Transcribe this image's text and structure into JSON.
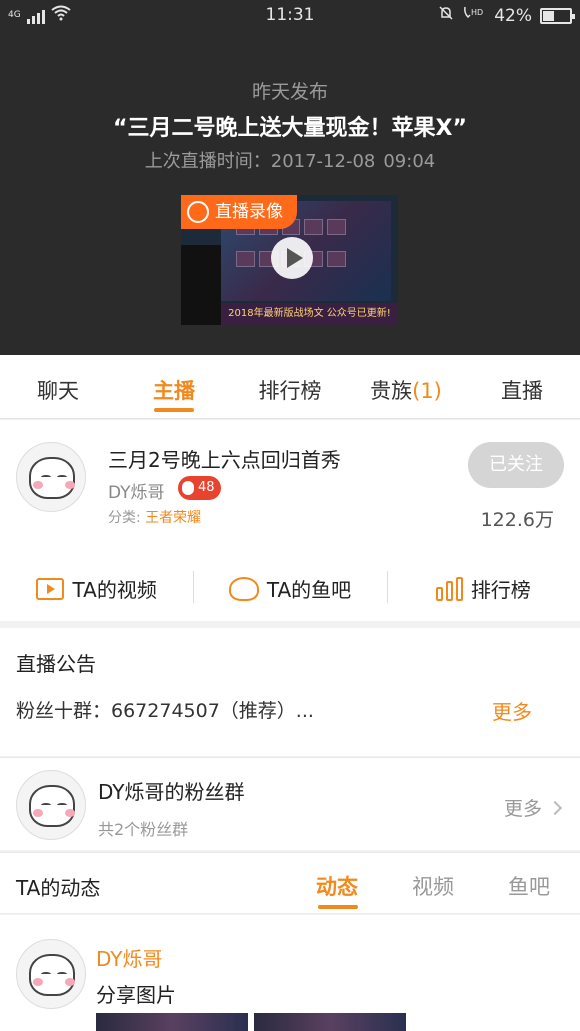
{
  "status_bar": {
    "time": "11:31",
    "network": "4G",
    "battery": "42%",
    "battery_level": 0.42,
    "icons": [
      "signal-icon",
      "wifi-icon",
      "mute-bell-icon",
      "hd-volte-icon",
      "battery-icon"
    ]
  },
  "header": {
    "posted": "昨天发布",
    "title": "“三月二号晚上送大量现金！苹果X”",
    "last_live_label": "上次直播时间：2017-12-08",
    "last_live_time": "09:04",
    "video_badge": "直播录像",
    "video_caption": "2018年最新版战场文 公众号已更新!"
  },
  "tabs": [
    {
      "label": "聊天",
      "count": ""
    },
    {
      "label": "主播",
      "count": ""
    },
    {
      "label": "排行榜",
      "count": ""
    },
    {
      "label": "贵族",
      "count": "(1)"
    },
    {
      "label": "直播",
      "count": ""
    }
  ],
  "active_tab": "主播",
  "anchor": {
    "title": "三月2号晚上六点回归首秀",
    "name": "DY烁哥",
    "level": "48",
    "category_label": "分类:",
    "category": "王者荣耀",
    "follow_label": "已关注",
    "fans": "122.6万"
  },
  "actions": [
    {
      "label": "TA的视频",
      "icon": "video-icon"
    },
    {
      "label": "TA的鱼吧",
      "icon": "fish-bar-icon"
    },
    {
      "label": "排行榜",
      "icon": "rank-bars-icon"
    }
  ],
  "notice": {
    "title": "直播公告",
    "text": "粉丝十群：667274507（推荐）...",
    "more": "更多"
  },
  "fan_group": {
    "title": "DY烁哥的粉丝群",
    "subtitle": "共2个粉丝群",
    "more": "更多"
  },
  "dynamics": {
    "title": "TA的动态",
    "tabs": [
      "动态",
      "视频",
      "鱼吧"
    ],
    "active": "动态"
  },
  "post": {
    "author": "DY烁哥",
    "text": "分享图片"
  },
  "colors": {
    "accent": "#f08a1f",
    "header_bg": "#2b2b2b",
    "level_badge": "#e8432e",
    "live_badge": "#ff6a1a"
  }
}
